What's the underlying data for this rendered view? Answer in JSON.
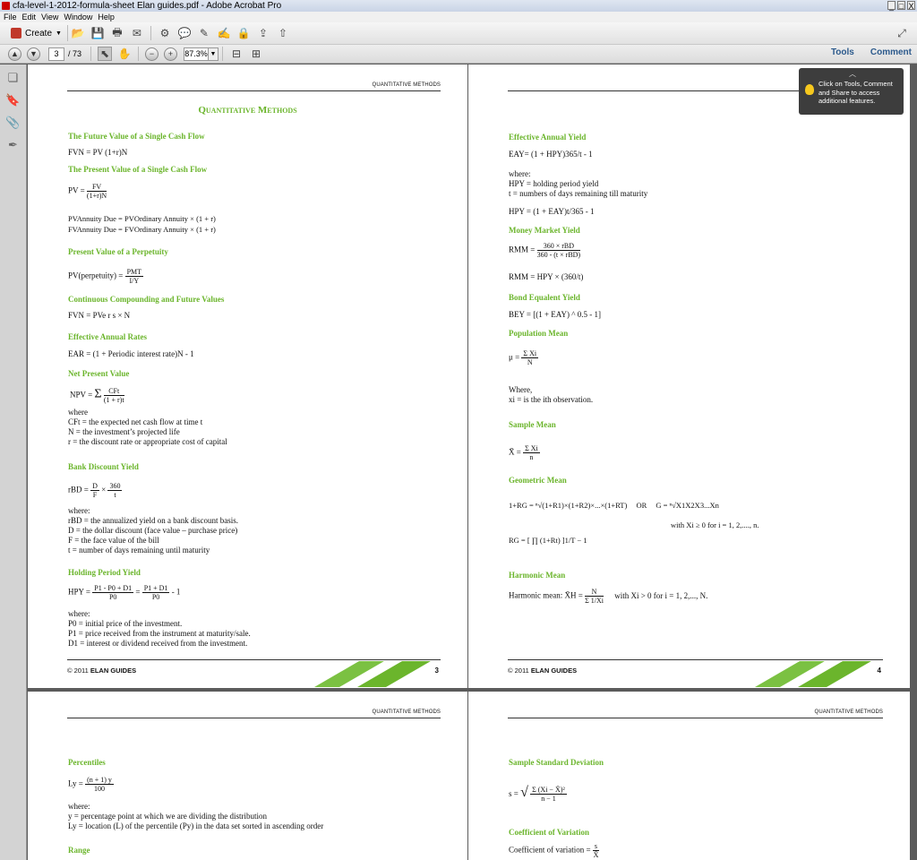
{
  "window": {
    "title": "cfa-level-1-2012-formula-sheet Elan guides.pdf - Adobe Acrobat Pro",
    "controls": [
      "_",
      "□",
      "X"
    ]
  },
  "menu": [
    "File",
    "Edit",
    "View",
    "Window",
    "Help"
  ],
  "toolbar": {
    "create_label": "Create",
    "page_current": "3",
    "page_total": "/ 73",
    "zoom": "87.3%",
    "tools_label": "Tools",
    "comment_label": "Comment"
  },
  "tooltip": {
    "text1": "Click on Tools, Comment",
    "text2": "and Share to access",
    "text3": "additional features."
  },
  "colors": {
    "accent_green": "#6bb52c",
    "link_blue": "#2c5a8c"
  },
  "pages": {
    "header": "QUANTITATIVE METHODS",
    "footer": "© 2011 ELAN GUIDES",
    "footer_pre": "© 2011",
    "footer_brand": "ELAN GUIDES",
    "p3_num": "3",
    "p4_num": "4",
    "p3": {
      "title": "Quantitative Methods",
      "fv_single": "The Future Value of a Single Cash Flow",
      "fv_formula": "FVN = PV (1+r)N",
      "pv_single": "The Present Value of a Single Cash Flow",
      "pv_formula": "PV =",
      "pv_num": "FV",
      "pv_den": "(1+r)N",
      "pv_annuity_due": "PVAnnuity Due = PVOrdinary Annuity × (1 + r)",
      "fv_annuity_due": "FVAnnuity Due = FVOrdinary Annuity × (1 + r)",
      "pv_perp": "Present Value of a Perpetuity",
      "pv_perp_formula": "PV(perpetuity) =",
      "pv_perp_num": "PMT",
      "pv_perp_den": "I/Y",
      "cont_comp": "Continuous Compounding and Future Values",
      "cont_formula": "FVN = PVe r s × N",
      "ear": "Effective Annual Rates",
      "ear_formula": "EAR = (1 + Periodic interest rate)N - 1",
      "npv": "Net Present Value",
      "npv_formula": "NPV =",
      "npv_num": "CFt",
      "npv_den": "(1 + r)t",
      "where": "where",
      "npv_w1": "CFt = the expected net cash flow at time t",
      "npv_w2": "N    = the investment’s projected life",
      "npv_w3": "r     = the discount rate or appropriate cost of capital",
      "bdy": "Bank Discount Yield",
      "bdy_formula": "rBD =",
      "bdy_f1_num": "D",
      "bdy_f1_den": "F",
      "bdy_f2_num": "360",
      "bdy_f2_den": "t",
      "where2": "where:",
      "bdy_w1": "rBD = the annualized yield on a bank discount basis.",
      "bdy_w2": "D = the dollar discount (face value – purchase price)",
      "bdy_w3": "F = the face value of the bill",
      "bdy_w4": "t = number of days remaining until maturity",
      "hpy": "Holding Period Yield",
      "hpy_formula": "HPY =",
      "hpy_f1_num": "P1 - P0 + D1",
      "hpy_f1_den": "P0",
      "hpy_f2_num": "P1 + D1",
      "hpy_f2_den": "P0",
      "hpy_tail": "- 1",
      "hpy_w1": "P0 = initial price of the investment.",
      "hpy_w2": "P1 = price received from the instrument at maturity/sale.",
      "hpy_w3": "D1 = interest or dividend received from the investment."
    },
    "p4": {
      "eay": "Effective Annual Yield",
      "eay_formula": "EAY= (1 + HPY)365/t - 1",
      "where": "where:",
      "eay_w1": "HPY = holding period yield",
      "eay_w2": "t = numbers of days remaining till maturity",
      "hpy_formula": "HPY = (1 + EAY)t/365 - 1",
      "mmy": "Money Market Yield",
      "mmy_formula": "RMM =",
      "mmy_num": "360 × rBD",
      "mmy_den": "360 - (t × rBD)",
      "mmy_formula2": "RMM = HPY × (360/t)",
      "bey": "Bond Equalent Yield",
      "bey_formula": "BEY = [(1 + EAY) ^ 0.5 - 1]",
      "pop_mean": "Population Mean",
      "pop_formula": "μ =",
      "pop_num": "Σ Xi",
      "pop_den": "N",
      "pop_w0": "Where,",
      "pop_w1": "xi = is the ith observation.",
      "sample_mean": "Sample Mean",
      "sample_formula": "X̄ =",
      "sample_num": "Σ Xi",
      "sample_den": "n",
      "geo_mean": "Geometric Mean",
      "geo_formula": "1+RG = ⁿ√(1+R1)×(1+R2)×...×(1+RT)",
      "geo_or": "OR",
      "geo_formula2": "G = ⁿ√X1X2X3...Xn",
      "geo_cond": "with Xi ≥ 0 for i = 1, 2,...., n.",
      "geo_formula3": "RG = [ ∏ (1+Rt) ]1/T − 1",
      "harm_mean": "Harmonic Mean",
      "harm_formula": "Harmonic mean: X̄H =",
      "harm_num": "N",
      "harm_den": "Σ 1/Xi",
      "harm_cond": "with Xi > 0 for i = 1, 2,..., N."
    },
    "p5": {
      "percentiles": "Percentiles",
      "perc_formula": "Ly =",
      "perc_num": "(n + 1) y",
      "perc_den": "100",
      "where": "where:",
      "perc_w1": "y = percentage point at which we are dividing the distribution",
      "perc_w2": "Ly = location (L) of the percentile (Py) in the data set sorted in ascending order",
      "range": "Range"
    },
    "p6": {
      "ssd": "Sample Standard Deviation",
      "ssd_formula": "s =",
      "ssd_num": "Σ (Xi − X̄)²",
      "ssd_den": "n − 1",
      "cov": "Coefficient of Variation",
      "cov_formula": "Coefficient of variation =",
      "cov_num": "s",
      "cov_den": "X̄"
    }
  }
}
